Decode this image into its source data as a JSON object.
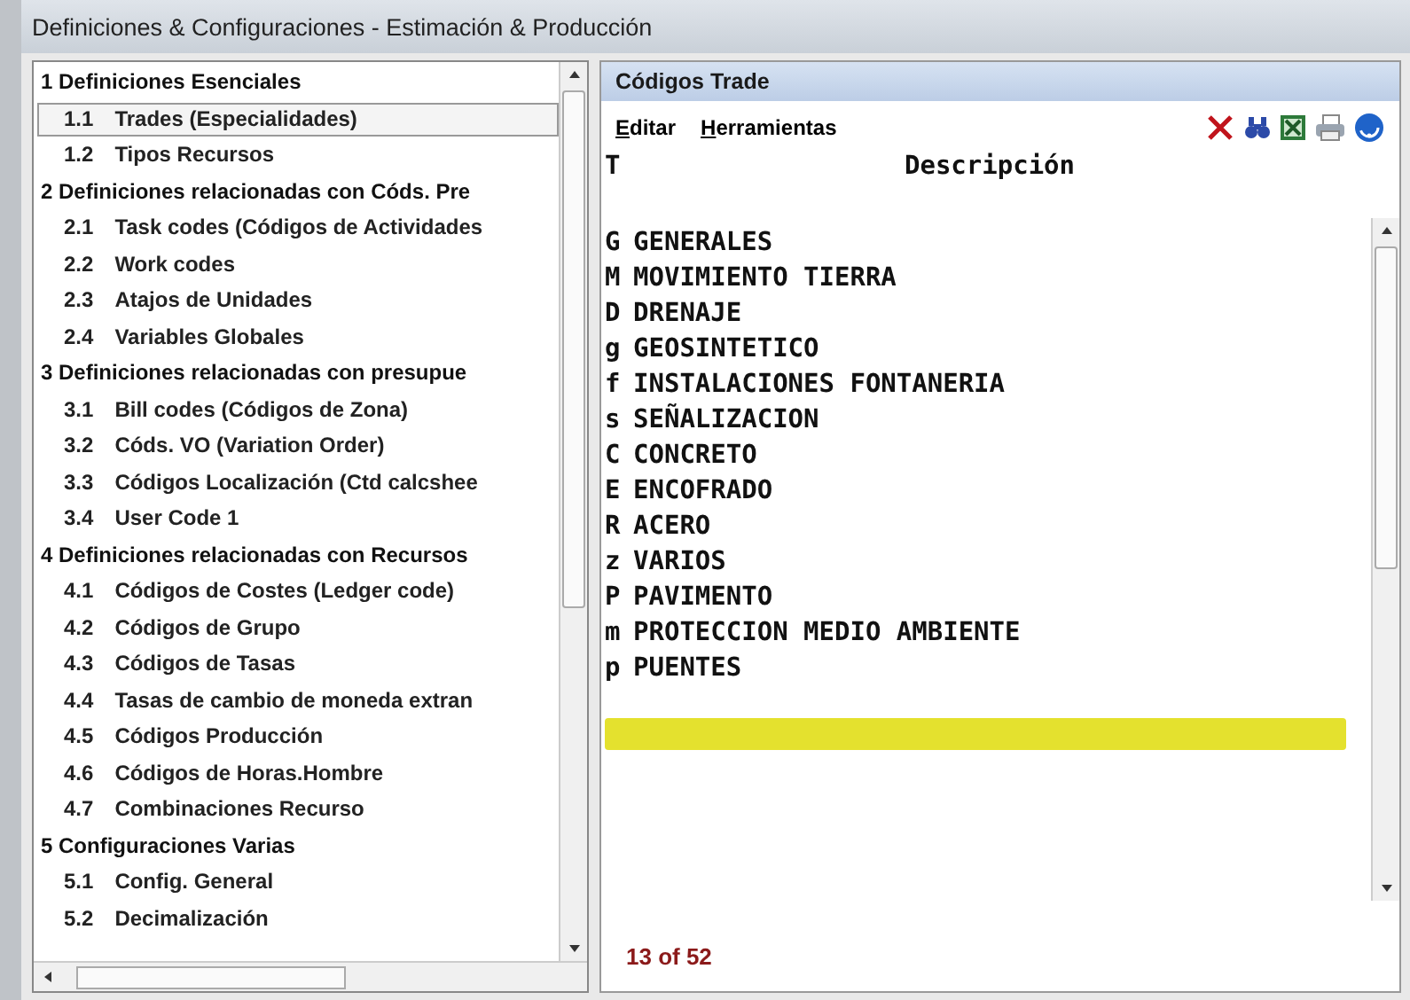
{
  "window": {
    "title": "Definiciones & Configuraciones - Estimación & Producción"
  },
  "sidebar": {
    "sections": [
      {
        "label": "1 Definiciones Esenciales",
        "children": [
          {
            "number": "1.1",
            "label": "Trades (Especialidades)",
            "selected": true
          },
          {
            "number": "1.2",
            "label": "Tipos Recursos",
            "selected": false
          }
        ]
      },
      {
        "label": "2 Definiciones relacionadas con Códs. Pre",
        "children": [
          {
            "number": "2.1",
            "label": "Task codes (Códigos de Actividades",
            "selected": false
          },
          {
            "number": "2.2",
            "label": "Work codes",
            "selected": false
          },
          {
            "number": "2.3",
            "label": "Atajos de Unidades",
            "selected": false
          },
          {
            "number": "2.4",
            "label": "Variables Globales",
            "selected": false
          }
        ]
      },
      {
        "label": "3 Definiciones relacionadas con presupue",
        "children": [
          {
            "number": "3.1",
            "label": "Bill codes (Códigos de Zona)",
            "selected": false
          },
          {
            "number": "3.2",
            "label": "Códs. VO (Variation Order)",
            "selected": false
          },
          {
            "number": "3.3",
            "label": "Códigos Localización (Ctd calcshee",
            "selected": false
          },
          {
            "number": "3.4",
            "label": "User Code 1",
            "selected": false
          }
        ]
      },
      {
        "label": "4 Definiciones relacionadas con Recursos",
        "children": [
          {
            "number": "4.1",
            "label": "Códigos de Costes (Ledger code)",
            "selected": false
          },
          {
            "number": "4.2",
            "label": "Códigos de Grupo",
            "selected": false
          },
          {
            "number": "4.3",
            "label": "Códigos de Tasas",
            "selected": false
          },
          {
            "number": "4.4",
            "label": "Tasas de cambio de moneda extran",
            "selected": false
          },
          {
            "number": "4.5",
            "label": "Códigos Producción",
            "selected": false
          },
          {
            "number": "4.6",
            "label": "Códigos de Horas.Hombre",
            "selected": false
          },
          {
            "number": "4.7",
            "label": "Combinaciones Recurso",
            "selected": false
          }
        ]
      },
      {
        "label": "5 Configuraciones Varias",
        "children": [
          {
            "number": "5.1",
            "label": "Config. General",
            "selected": false
          },
          {
            "number": "5.2",
            "label": "Decimalización",
            "selected": false
          }
        ]
      }
    ]
  },
  "panel": {
    "title": "Códigos Trade",
    "menu": [
      "Editar",
      "Herramientas"
    ],
    "table": {
      "columns": [
        "T",
        "Descripción"
      ],
      "rows": [
        {
          "code": "G",
          "description": "GENERALES"
        },
        {
          "code": "M",
          "description": "MOVIMIENTO TIERRA"
        },
        {
          "code": "D",
          "description": "DRENAJE"
        },
        {
          "code": "g",
          "description": "GEOSINTETICO"
        },
        {
          "code": "f",
          "description": "INSTALACIONES FONTANERIA"
        },
        {
          "code": "s",
          "description": "SEÑALIZACION"
        },
        {
          "code": "C",
          "description": "CONCRETO"
        },
        {
          "code": "E",
          "description": "ENCOFRADO"
        },
        {
          "code": "R",
          "description": "ACERO"
        },
        {
          "code": "z",
          "description": "VARIOS"
        },
        {
          "code": "P",
          "description": "PAVIMENTO"
        },
        {
          "code": "m",
          "description": "PROTECCION MEDIO AMBIENTE"
        },
        {
          "code": "p",
          "description": "PUENTES"
        }
      ],
      "new_row": {
        "selected": true
      }
    },
    "record_count": "13 of 52"
  }
}
